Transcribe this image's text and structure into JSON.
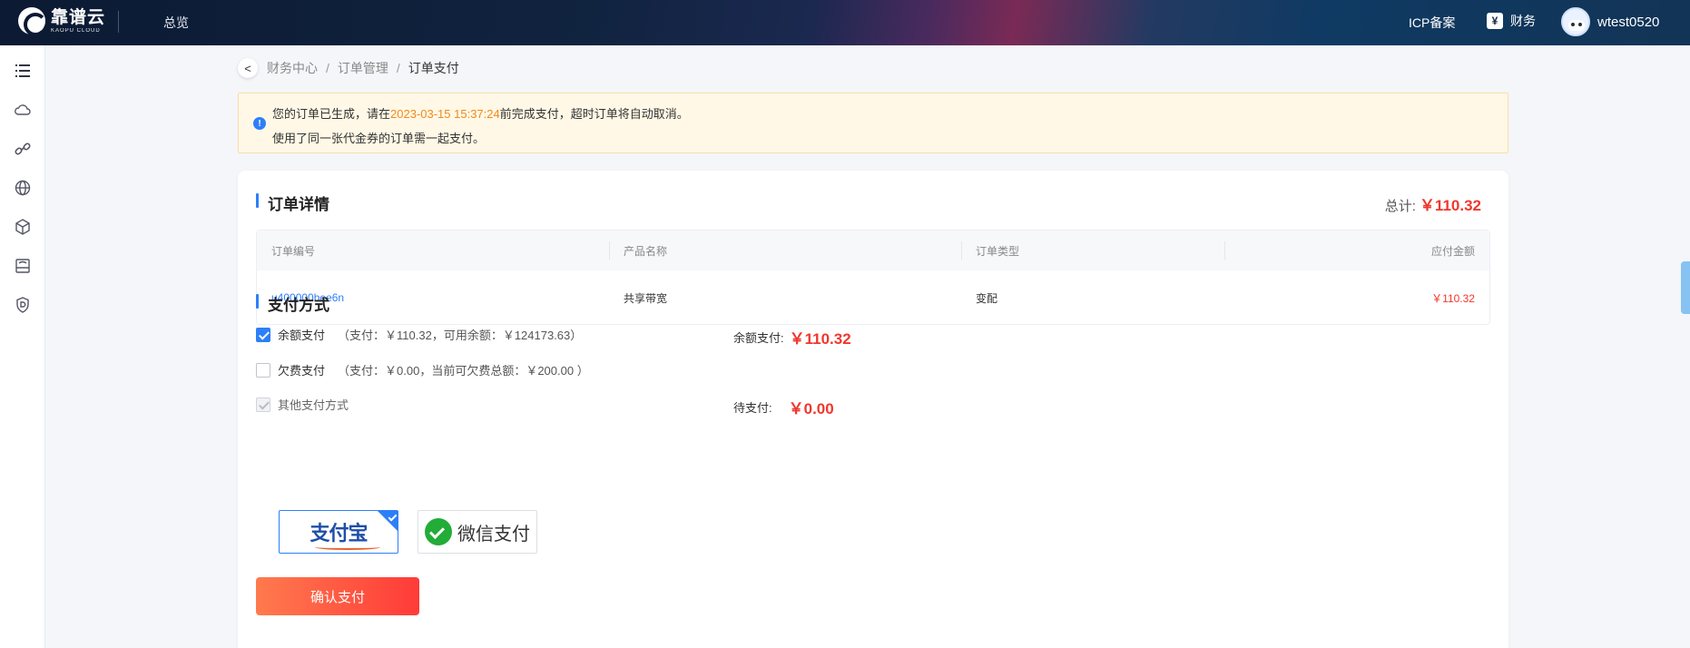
{
  "topbar": {
    "logo_cn": "靠谱云",
    "logo_en": "KAOPU CLOUD",
    "nav_overview": "总览",
    "nav_icp": "ICP备案",
    "nav_finance": "财务",
    "finance_icon_glyph": "¥",
    "username": "wtest0520"
  },
  "sidebar": {
    "icons": [
      "list-icon",
      "cloud-icon",
      "link-icon",
      "globe-icon",
      "cube-network-icon",
      "storage-icon",
      "shield-icon"
    ]
  },
  "breadcrumb": {
    "back": "<",
    "items": [
      "财务中心",
      "订单管理",
      "订单支付"
    ],
    "sep": "/"
  },
  "notice": {
    "line1_prefix": "您的订单已生成，请在",
    "deadline": "2023-03-15 15:37:24",
    "line1_suffix": "前完成支付，超时订单将自动取消。",
    "line2": "使用了同一张代金券的订单需一起支付。",
    "icon_glyph": "!"
  },
  "order": {
    "title": "订单详情",
    "total_label": "总计:",
    "total_amount": "￥110.32",
    "columns": [
      "订单编号",
      "产品名称",
      "订单类型",
      "应付金额"
    ],
    "rows": [
      {
        "id": "u400000bee6n",
        "product": "共享带宽",
        "type": "变配",
        "amount": "￥110.32"
      }
    ]
  },
  "payment": {
    "title": "支付方式",
    "balance_label": "余额支付",
    "balance_detail": "（支付：￥110.32，可用余额：￥124173.63）",
    "arrears_label": "欠费支付",
    "arrears_detail": "（支付：￥0.00，当前可欠费总额：￥200.00 ）",
    "other_label": "其他支付方式",
    "balance_summary_label": "余额支付:",
    "balance_summary_amount": "￥110.32",
    "pending_label": "待支付:",
    "pending_amount": "￥0.00",
    "methods": {
      "alipay": "支付宝",
      "wechat": "微信支付"
    },
    "confirm": "确认支付"
  },
  "colors": {
    "accent": "#2d7ff9",
    "price_red": "#f0372e",
    "deadline_orange": "#f08a1b"
  }
}
